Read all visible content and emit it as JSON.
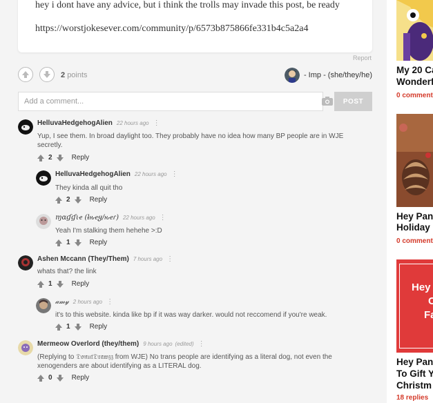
{
  "post": {
    "line1": "hey i dont have any advice, but i think the trolls may invade this post, be ready",
    "link": "https://worstjokesever.com/community/p/6573b875866fe331b4c5a2a4",
    "report_label": "Report"
  },
  "votes": {
    "count": "2",
    "label": "points"
  },
  "author": {
    "name": "- Imp - (she/they/he)"
  },
  "comment_form": {
    "placeholder": "Add a comment...",
    "post_label": "POST"
  },
  "comments": [
    {
      "name": "HelluvaHedgehogAlien",
      "time": "22 hours ago",
      "text": "Yup, I see them. In broad daylight too. They probably have no idea how many BP people are in WJE secretly.",
      "votes": "2",
      "reply": "Reply"
    },
    {
      "name": "HelluvaHedgehogAlien",
      "time": "22 hours ago",
      "text": "They kinda all quit tho",
      "votes": "2",
      "reply": "Reply"
    },
    {
      "name": "ɱαɠɠιҽ (ƚԋҽყ/ԋҽɾ)",
      "time": "22 hours ago",
      "text": "Yeah I'm stalking them hehehe >:D",
      "votes": "1",
      "reply": "Reply"
    },
    {
      "name": "Ashen Mccann (They/Them)",
      "time": "7 hours ago",
      "text": "whats that? the link",
      "votes": "1",
      "reply": "Reply"
    },
    {
      "name": "𝒶𝓂𝓎",
      "time": "2 hours ago",
      "text": "it's to this website. kinda like bp if it was way darker. would not reccomend if you're weak.",
      "votes": "1",
      "reply": "Reply"
    },
    {
      "name": "Mermeow Overlord (they/them)",
      "time": "9 hours ago",
      "edited": "(edited)",
      "text_prefix": "(Replying to ",
      "text_mention": "𝔇𝔬𝔫𝔲𝔱𝔇𝔯𝔞𝔴𝔷𝔷",
      "text_rest": " from WJE) No trans people are identifying as a literal dog, not even the xenogenders are about identifying as a LITERAL dog.",
      "votes": "0",
      "reply": "Reply"
    }
  ],
  "sidebar": {
    "articles": [
      {
        "title_line1": "My 20 Ca",
        "title_line2": "Wonderf",
        "count": "0 comment"
      },
      {
        "title_line1": "Hey Pan",
        "title_line2": "Holiday",
        "count": "0 comment"
      },
      {
        "banner_line1": "Hey",
        "banner_line2": "C",
        "banner_line3": "Fa",
        "title_line1": "Hey Pan",
        "title_line2": "To Gift Y",
        "title_line3": "Christm",
        "count": "18 replies"
      }
    ]
  },
  "colors": {
    "accent": "#d43a2a",
    "banner": "#e03a3a"
  }
}
